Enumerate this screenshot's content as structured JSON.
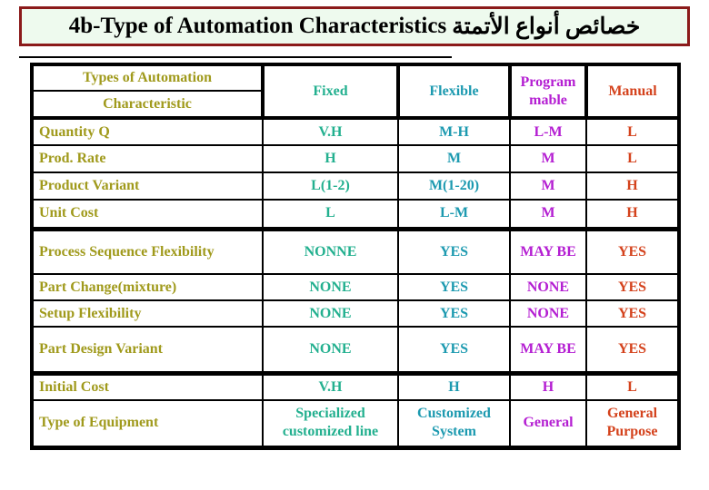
{
  "title": {
    "english": "4b-Type of Automation Characteristics",
    "arabic": "خصائص أنواع الأتمتة"
  },
  "table": {
    "header": {
      "corner_top": "Types of Automation",
      "corner_bottom": "Characteristic",
      "columns": [
        "Fixed",
        "Flexible",
        "Program mable",
        "Manual"
      ]
    },
    "column_colors": {
      "label": "#a09a1c",
      "fixed": "#23b08f",
      "flexible": "#1d9ab0",
      "programmable": "#b41ed2",
      "manual": "#d4421c"
    },
    "rows": [
      {
        "label": "Quantity Q",
        "values": [
          "V.H",
          "M-H",
          "L-M",
          "L"
        ]
      },
      {
        "label": "Prod. Rate",
        "values": [
          "H",
          "M",
          "M",
          "L"
        ]
      },
      {
        "label": "Product Variant",
        "values": [
          "L(1-2)",
          "M(1-20)",
          "M",
          "H"
        ]
      },
      {
        "label": "Unit Cost",
        "values": [
          "L",
          "L-M",
          "M",
          "H"
        ]
      },
      {
        "label": "Process Sequence Flexibility",
        "values": [
          "NONNE",
          "YES",
          "MAY BE",
          "YES"
        ]
      },
      {
        "label": "Part Change(mixture)",
        "values": [
          "NONE",
          "YES",
          "NONE",
          "YES"
        ]
      },
      {
        "label": "Setup Flexibility",
        "values": [
          "NONE",
          "YES",
          "NONE",
          "YES"
        ]
      },
      {
        "label": "Part Design Variant",
        "values": [
          "NONE",
          "YES",
          "MAY BE",
          "YES"
        ]
      },
      {
        "label": "Initial Cost",
        "values": [
          "V.H",
          "H",
          "H",
          "L"
        ]
      },
      {
        "label": "Type of Equipment",
        "values": [
          "Specialized customized line",
          "Customized System",
          "General",
          "General Purpose"
        ]
      }
    ]
  }
}
